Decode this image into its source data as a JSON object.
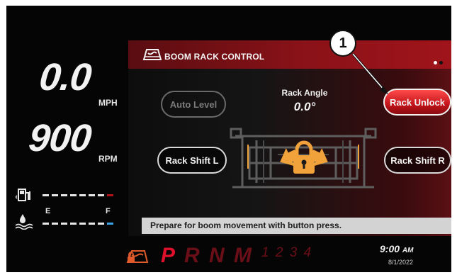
{
  "speed": {
    "value": "0.0",
    "unit": "MPH"
  },
  "rpm": {
    "value": "900",
    "unit": "RPM"
  },
  "water_gauge": {
    "empty_label": "E",
    "full_label": "F"
  },
  "panel": {
    "title": "BOOM RACK CONTROL"
  },
  "buttons": {
    "auto_level": "Auto Level",
    "rack_unlock": "Rack Unlock",
    "shift_left": "Rack Shift L",
    "shift_right": "Rack Shift R"
  },
  "rack_angle": {
    "label": "Rack Angle",
    "value": "0.0°"
  },
  "status_message": "Prepare for boom movement with button press.",
  "gear": {
    "active": "P",
    "inactive": [
      "R",
      "N",
      "M"
    ],
    "manual": "1 2 3 4"
  },
  "clock": {
    "time": "9:00",
    "ampm": "AM",
    "date": "8/1/2022"
  },
  "callout": {
    "number": "1"
  },
  "colors": {
    "accent_red": "#c4141a",
    "fuel_marker": "#b3121a",
    "water_marker": "#3aa3e6",
    "lock_orange": "#f2a23a"
  }
}
